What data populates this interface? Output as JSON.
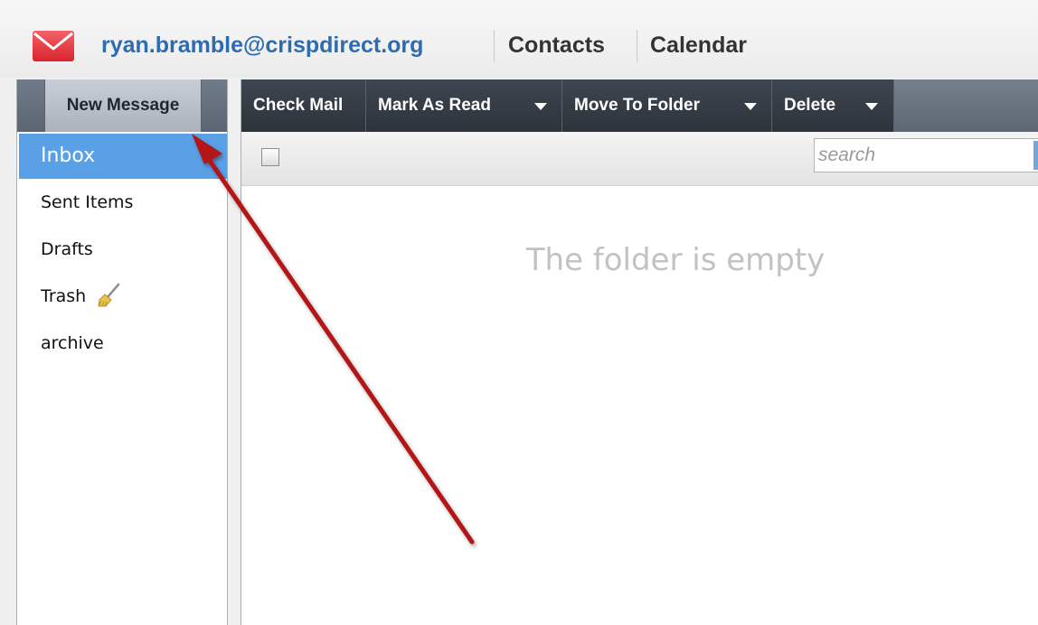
{
  "header": {
    "account_email": "ryan.bramble@crispdirect.org",
    "contacts_label": "Contacts",
    "calendar_label": "Calendar",
    "logo_icon": "envelope-icon"
  },
  "sidebar": {
    "new_message_label": "New Message",
    "folders": [
      {
        "label": "Inbox",
        "active": true
      },
      {
        "label": "Sent Items",
        "active": false
      },
      {
        "label": "Drafts",
        "active": false
      },
      {
        "label": "Trash",
        "active": false,
        "icon": "broom-icon"
      },
      {
        "label": "archive",
        "active": false
      }
    ]
  },
  "toolbar": {
    "check_mail_label": "Check Mail",
    "mark_as_read_label": "Mark As Read",
    "move_to_folder_label": "Move To Folder",
    "delete_label": "Delete"
  },
  "list": {
    "search_placeholder": "search",
    "empty_message": "The folder is empty"
  },
  "colors": {
    "accent": "#2d6cb0",
    "active_folder": "#5aa0e6",
    "toolbar": "#333a43",
    "annotation_arrow": "#b31217"
  }
}
